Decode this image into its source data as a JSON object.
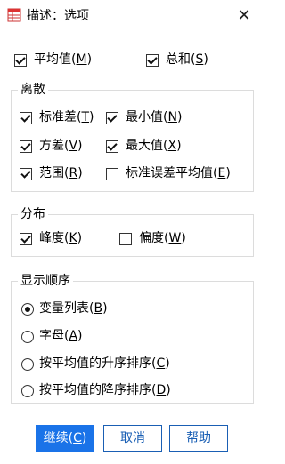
{
  "window": {
    "title": "描述：选项",
    "close_glyph": "✕"
  },
  "top_options": [
    {
      "label": "平均值",
      "mnemonic": "M",
      "checked": true
    },
    {
      "label": "总和",
      "mnemonic": "S",
      "checked": true
    }
  ],
  "dispersion": {
    "title": "离散",
    "items": [
      {
        "label": "标准差",
        "mnemonic": "T",
        "checked": true
      },
      {
        "label": "最小值",
        "mnemonic": "N",
        "checked": true
      },
      {
        "label": "方差",
        "mnemonic": "V",
        "checked": true
      },
      {
        "label": "最大值",
        "mnemonic": "X",
        "checked": true
      },
      {
        "label": "范围",
        "mnemonic": "R",
        "checked": true
      },
      {
        "label": "标准误差平均值",
        "mnemonic": "E",
        "checked": false
      }
    ]
  },
  "distribution": {
    "title": "分布",
    "items": [
      {
        "label": "峰度",
        "mnemonic": "K",
        "checked": true
      },
      {
        "label": "偏度",
        "mnemonic": "W",
        "checked": false
      }
    ]
  },
  "display_order": {
    "title": "显示顺序",
    "options": [
      {
        "label": "变量列表",
        "mnemonic": "B",
        "selected": true
      },
      {
        "label": "字母",
        "mnemonic": "A",
        "selected": false
      },
      {
        "label": "按平均值的升序排序",
        "mnemonic": "C",
        "selected": false
      },
      {
        "label": "按平均值的降序排序",
        "mnemonic": "D",
        "selected": false
      }
    ]
  },
  "buttons": {
    "continue": {
      "label": "继续",
      "mnemonic": "C"
    },
    "cancel": {
      "label": "取消"
    },
    "help": {
      "label": "帮助"
    }
  }
}
